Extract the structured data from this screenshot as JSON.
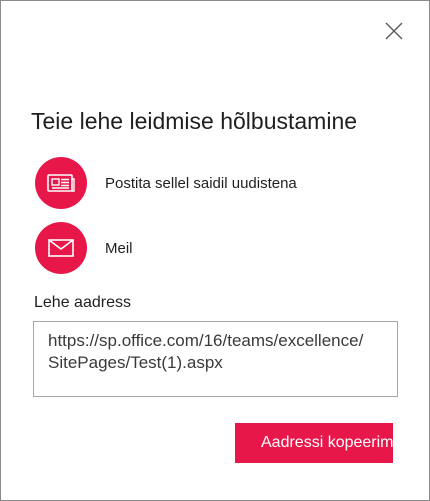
{
  "dialog": {
    "title": "Teie lehe leidmise hõlbustamine",
    "close_icon": "close-icon"
  },
  "options": [
    {
      "label": "Postita sellel saidil uudistena",
      "icon": "news-icon"
    },
    {
      "label": "Meil",
      "icon": "mail-icon"
    }
  ],
  "address": {
    "label": "Lehe aadress",
    "line1": "https://sp.office.com/16/teams/excellence/",
    "line2": "SitePages/Test(1).aspx"
  },
  "copy_button": {
    "label": "Aadressi kopeerimine"
  },
  "colors": {
    "accent": "#e8174a"
  }
}
